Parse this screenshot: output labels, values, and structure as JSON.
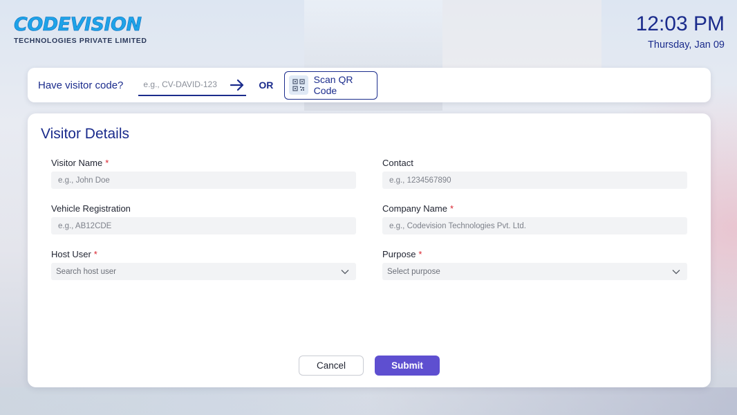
{
  "brand": {
    "name": "CODEVISION",
    "tagline": "TECHNOLOGIES PRIVATE LIMITED"
  },
  "clock": {
    "time": "12:03 PM",
    "date": "Thursday, Jan 09"
  },
  "code_bar": {
    "label": "Have visitor code?",
    "placeholder": "e.g., CV-DAVID-123",
    "value": "",
    "or_text": "OR",
    "scan_label": "Scan QR Code",
    "submit_icon": "arrow-right-icon",
    "scan_icon": "qr-code-icon"
  },
  "form": {
    "title": "Visitor Details",
    "required_mark": "*",
    "fields": {
      "visitor_name": {
        "label": "Visitor Name",
        "placeholder": "e.g., John Doe",
        "value": ""
      },
      "contact": {
        "label": "Contact",
        "placeholder": "e.g., 1234567890",
        "value": ""
      },
      "vehicle_registration": {
        "label": "Vehicle Registration",
        "placeholder": "e.g., AB12CDE",
        "value": ""
      },
      "company_name": {
        "label": "Company Name",
        "placeholder": "e.g., Codevision Technologies Pvt. Ltd.",
        "value": ""
      },
      "host_user": {
        "label": "Host User",
        "placeholder": "Search host user",
        "icon": "chevron-down-icon"
      },
      "purpose": {
        "label": "Purpose",
        "placeholder": "Select purpose",
        "icon": "chevron-down-icon"
      }
    },
    "cancel_label": "Cancel",
    "submit_label": "Submit"
  },
  "colors": {
    "primary": "#1a2b8c",
    "accent": "#5e4fd0",
    "required": "#d9232e",
    "logo": "#1ea3e8"
  }
}
